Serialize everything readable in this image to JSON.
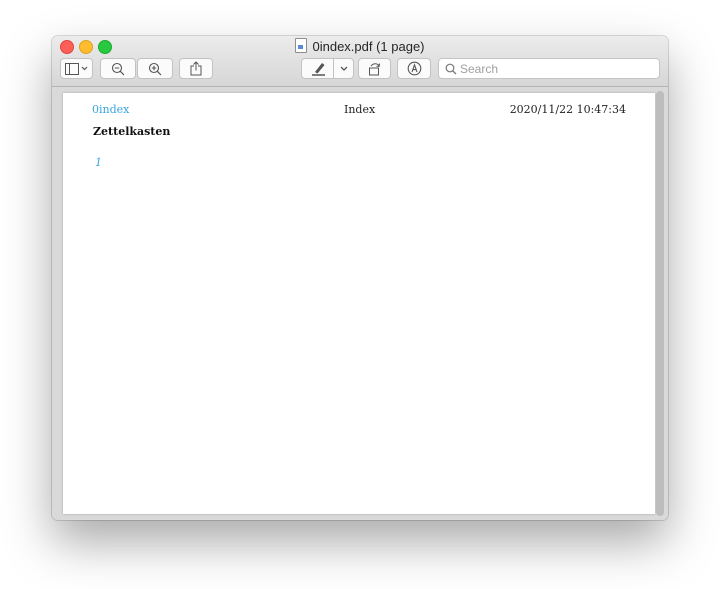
{
  "window": {
    "title": "0index.pdf (1 page)"
  },
  "toolbar": {
    "buttons": [
      {
        "name": "sidebar-toggle",
        "icon": "sidebar-icon"
      },
      {
        "name": "zoom-out",
        "icon": "zoom-out-icon"
      },
      {
        "name": "zoom-in",
        "icon": "zoom-in-icon"
      },
      {
        "name": "share",
        "icon": "share-icon"
      },
      {
        "name": "highlight",
        "icon": "highlighter-icon"
      },
      {
        "name": "rotate",
        "icon": "rotate-icon"
      },
      {
        "name": "markup",
        "icon": "markup-icon"
      }
    ],
    "search": {
      "placeholder": "Search",
      "value": ""
    }
  },
  "document": {
    "header_left": "0index",
    "header_center": "Index",
    "header_right": "2020/11/22 10:47:34",
    "title": "Zettelkasten",
    "link": "1"
  },
  "colors": {
    "link": "#3aa6dd",
    "close": "#fe5f57",
    "minimize": "#febc2e",
    "maximize": "#28c840"
  }
}
